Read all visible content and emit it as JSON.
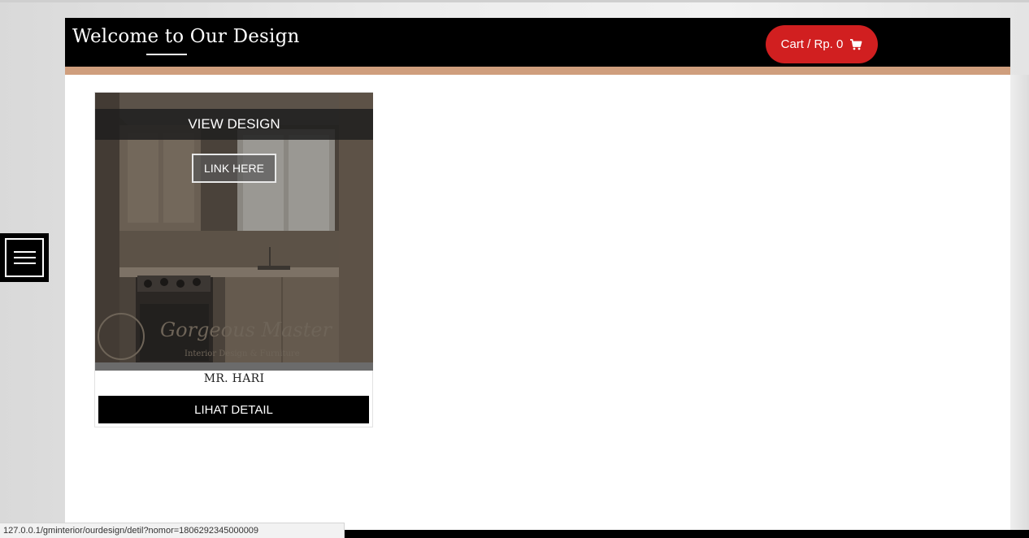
{
  "header": {
    "title": "Welcome to Our Design",
    "cart_label": "Cart / Rp. 0",
    "cart_icon": "shopping-cart-icon"
  },
  "colors": {
    "header_bg": "#000000",
    "accent_bar": "#cf9e7d",
    "cart_button": "#d11f20"
  },
  "menu": {
    "icon": "hamburger-menu-icon"
  },
  "products": [
    {
      "overlay_title": "VIEW DESIGN",
      "link_label": "LINK HERE",
      "name": "MR. HARI",
      "detail_label": "LIHAT DETAIL",
      "image": "kitchen-interior-photo"
    }
  ],
  "status_bar": {
    "url": "127.0.0.1/gminterior/ourdesign/detil?nomor=1806292345000009"
  }
}
